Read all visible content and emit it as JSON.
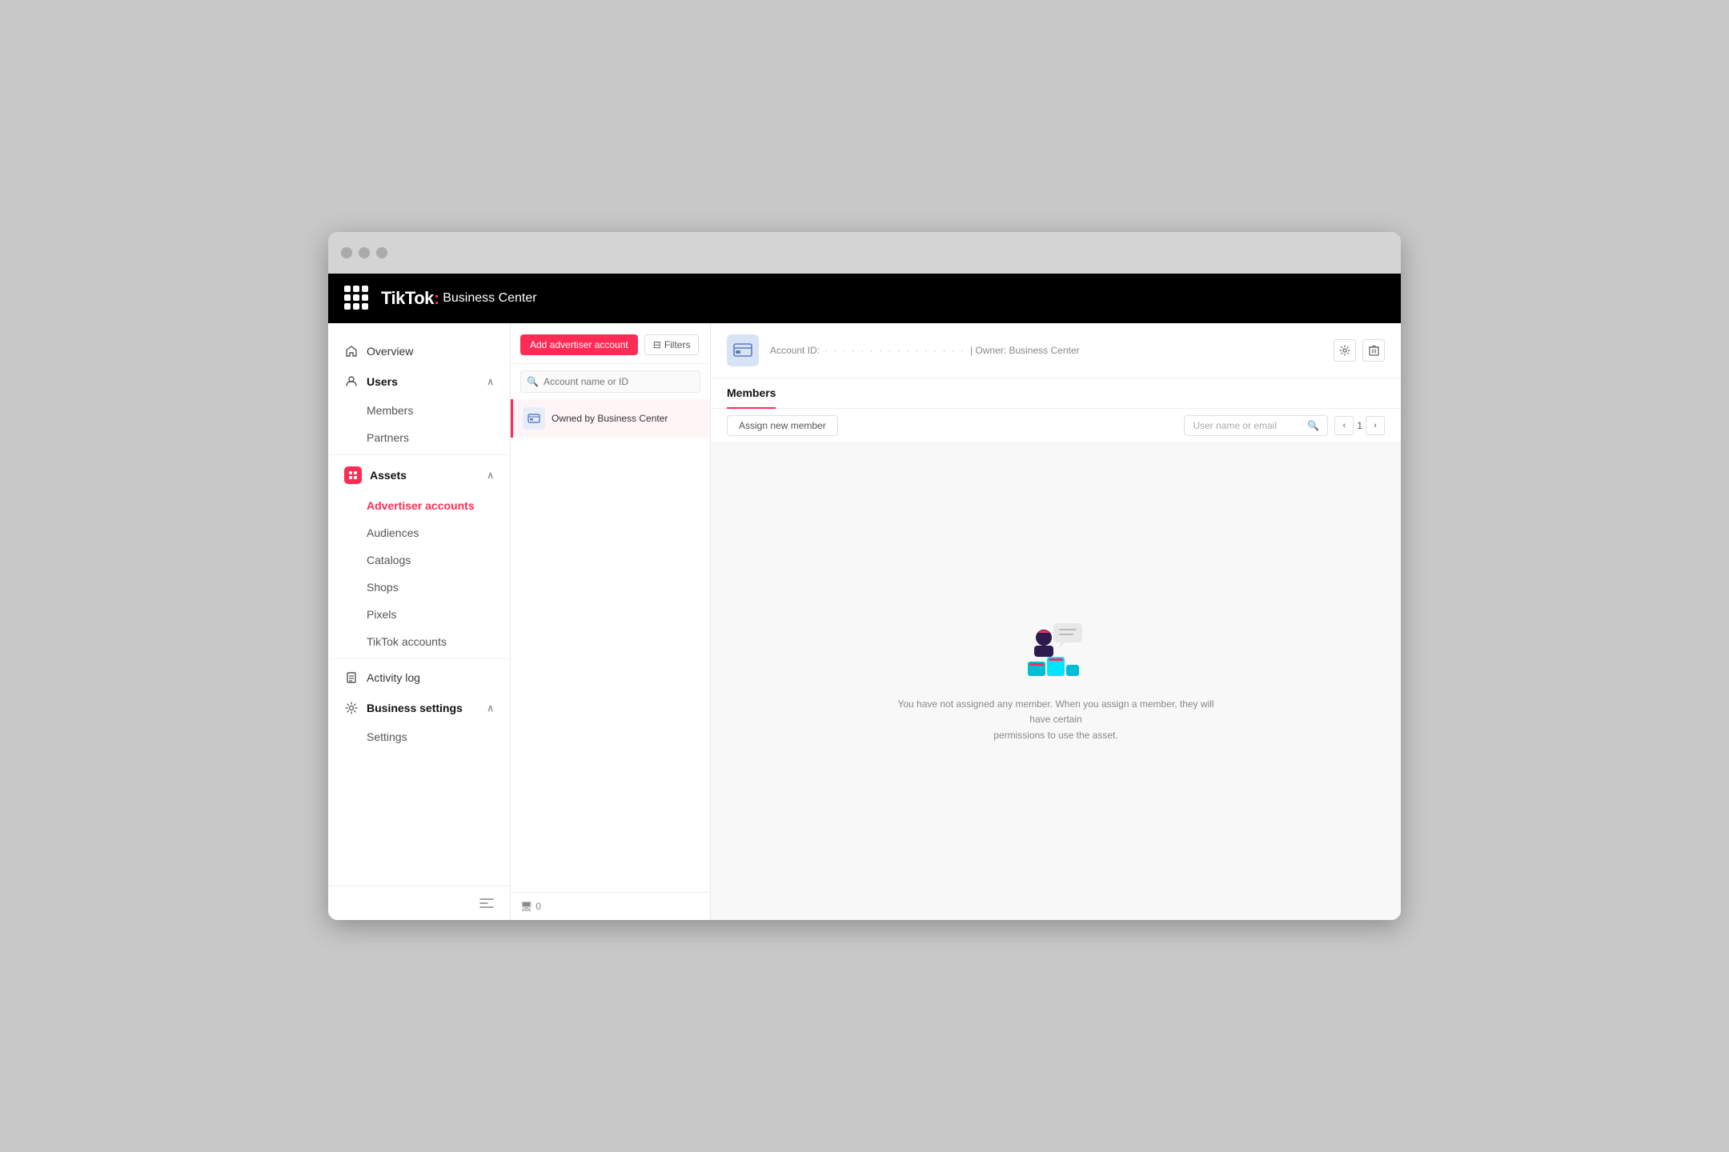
{
  "browser": {
    "dots": 3
  },
  "topnav": {
    "brand_name": "TikTok",
    "brand_separator": ":",
    "brand_section": " Business Center"
  },
  "sidebar": {
    "items": [
      {
        "id": "overview",
        "label": "Overview",
        "icon": "home-icon"
      },
      {
        "id": "users",
        "label": "Users",
        "icon": "user-icon",
        "expanded": true,
        "children": [
          {
            "id": "members",
            "label": "Members"
          },
          {
            "id": "partners",
            "label": "Partners"
          }
        ]
      },
      {
        "id": "assets",
        "label": "Assets",
        "icon": "assets-icon",
        "expanded": true,
        "children": [
          {
            "id": "advertiser-accounts",
            "label": "Advertiser accounts",
            "active": true
          },
          {
            "id": "audiences",
            "label": "Audiences"
          },
          {
            "id": "catalogs",
            "label": "Catalogs"
          },
          {
            "id": "shops",
            "label": "Shops"
          },
          {
            "id": "pixels",
            "label": "Pixels"
          },
          {
            "id": "tiktok-accounts",
            "label": "TikTok accounts"
          }
        ]
      },
      {
        "id": "activity-log",
        "label": "Activity log",
        "icon": "activity-icon"
      },
      {
        "id": "business-settings",
        "label": "Business settings",
        "icon": "settings-icon",
        "expanded": true,
        "children": [
          {
            "id": "settings",
            "label": "Settings"
          }
        ]
      }
    ],
    "collapse_label": "Collapse"
  },
  "middle_panel": {
    "add_button": "Add advertiser account",
    "filter_button": "Filters",
    "search_placeholder": "Account name or ID",
    "account_item": {
      "label": "Owned by Business Center"
    },
    "footer_icon": "monitor-icon",
    "footer_count": "0"
  },
  "right_panel": {
    "header": {
      "account_id_label": "Account ID:",
      "account_id_dots": "· · · · · · · · · · · · · · · ·",
      "owner_label": "| Owner: Business Center",
      "settings_icon": "settings-icon",
      "delete_icon": "delete-icon"
    },
    "tabs": [
      {
        "id": "members",
        "label": "Members",
        "active": true
      }
    ],
    "toolbar": {
      "assign_button": "Assign new member",
      "search_placeholder": "User name or email",
      "page_number": "1"
    },
    "empty_state": {
      "message_line1": "You have not assigned any member. When you assign a member, they will have certain",
      "message_line2": "permissions to use the asset."
    }
  }
}
